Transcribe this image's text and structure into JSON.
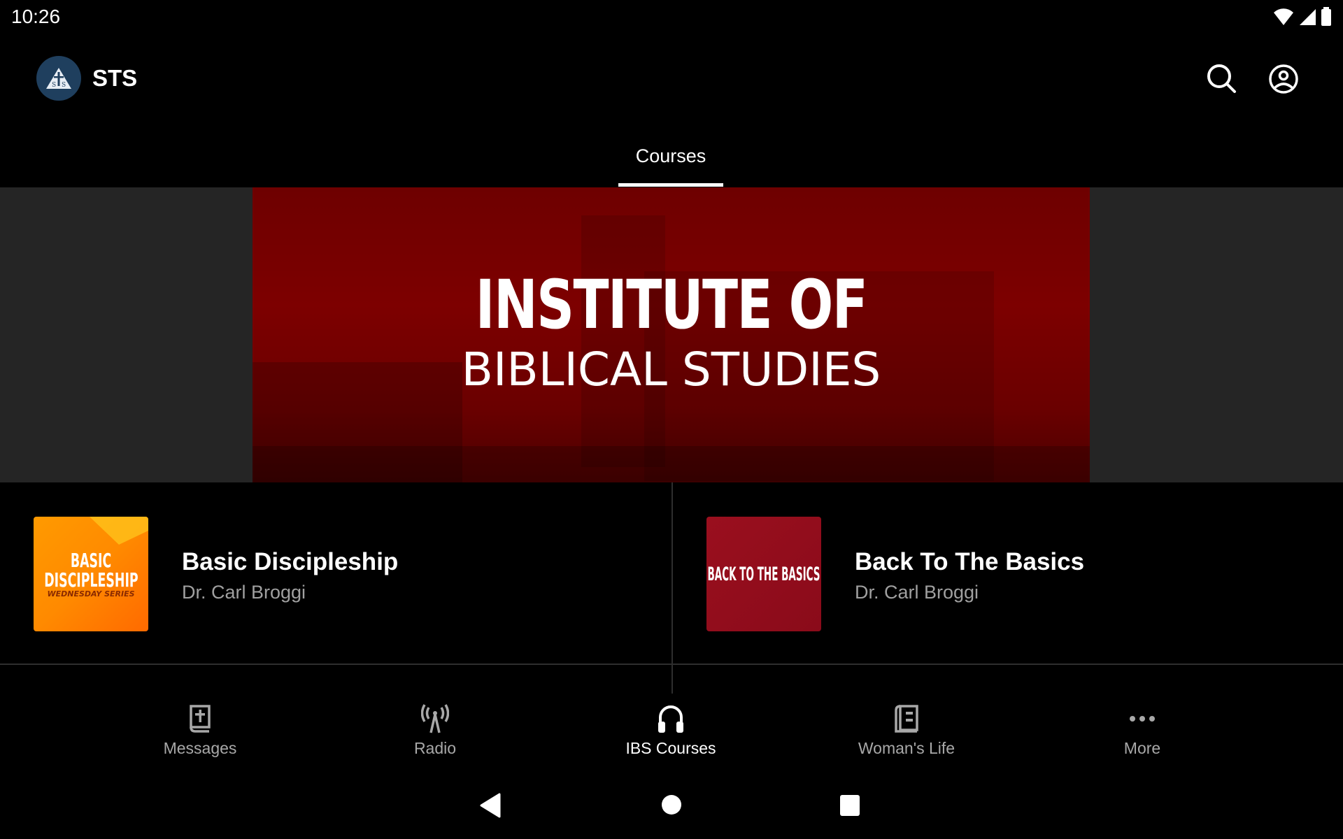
{
  "status_bar": {
    "time": "10:26",
    "icons": [
      "wifi-icon",
      "signal-icon",
      "battery-icon"
    ]
  },
  "app_bar": {
    "title": "STS",
    "logo": "sts-logo",
    "actions": [
      {
        "icon": "search-icon"
      },
      {
        "icon": "account-icon"
      }
    ]
  },
  "tabs": [
    {
      "label": "Courses",
      "active": true
    }
  ],
  "banner": {
    "line1": "INSTITUTE OF",
    "line2": "BIBLICAL STUDIES",
    "color": "#7a0000"
  },
  "courses": [
    {
      "title": "Basic Discipleship",
      "author": "Dr. Carl Broggi",
      "thumb_line1": "BASIC",
      "thumb_line2": "DISCIPLESHIP",
      "thumb_line3": "WEDNESDAY SERIES",
      "thumb_color": "#ff8c00"
    },
    {
      "title": "Back To The Basics",
      "author": "Dr. Carl Broggi",
      "thumb_line1": "BACK TO THE BASICS",
      "thumb_color": "#950e1c"
    }
  ],
  "bottom_nav": [
    {
      "label": "Messages",
      "icon": "bible-icon",
      "active": false
    },
    {
      "label": "Radio",
      "icon": "radio-tower-icon",
      "active": false
    },
    {
      "label": "IBS Courses",
      "icon": "headphones-icon",
      "active": true
    },
    {
      "label": "Woman's Life",
      "icon": "book-icon",
      "active": false
    },
    {
      "label": "More",
      "icon": "more-icon",
      "active": false
    }
  ],
  "system_nav": [
    "back",
    "home",
    "recents"
  ]
}
